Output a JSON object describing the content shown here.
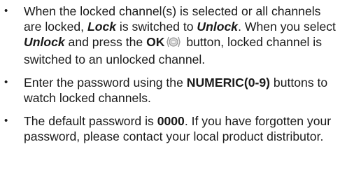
{
  "bullet_symbol": "•",
  "items": [
    {
      "part1": "When the locked channel(s) is selected or all channels are locked, ",
      "lock": "Lock",
      "part2": " is switched to ",
      "unlock1": "Unlock",
      "part3": ". When you select ",
      "unlock2": "Unlock",
      "part4": " and press the ",
      "ok": "OK",
      "part5": " button, locked channel is switched to an unlocked channel."
    },
    {
      "part1": "Enter the password using the ",
      "numeric": "NUMERIC(0-9)",
      "part2": " buttons to watch locked channels."
    },
    {
      "part1": "The default password is ",
      "password": "0000",
      "part2": ". If you have forgotten your password, please contact your local product distributor."
    }
  ],
  "icons": {
    "ok_button_icon": "ok-button-icon"
  }
}
